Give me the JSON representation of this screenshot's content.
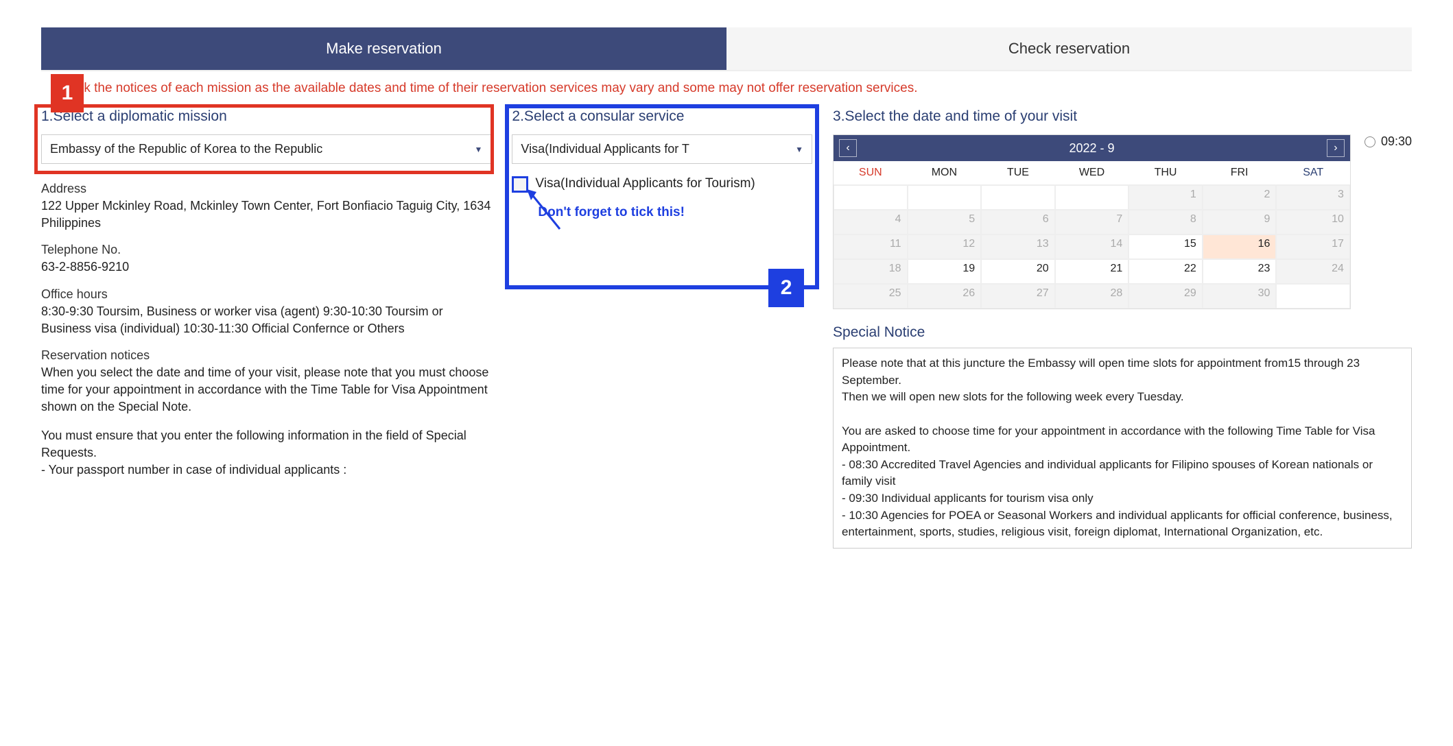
{
  "tabs": {
    "make": "Make reservation",
    "check": "Check reservation"
  },
  "top_notice": "check the notices of each mission as the available dates and time of their reservation services may vary and some may not offer reservation services.",
  "step1": {
    "title": "1.Select a diplomatic mission",
    "selected": "Embassy of the Republic of Korea to the Republic",
    "address_label": "Address",
    "address": "122 Upper Mckinley Road, Mckinley Town Center, Fort Bonfiacio Taguig City, 1634 Philippines",
    "tel_label": "Telephone No.",
    "tel": "63-2-8856-9210",
    "hours_label": "Office hours",
    "hours": "8:30-9:30 Toursim, Business or worker visa (agent) 9:30-10:30 Toursim or Business visa (individual) 10:30-11:30 Official Confernce or Others",
    "resv_label": "Reservation notices",
    "resv1": "When you select the date and time of your visit, please note that you must choose time for your appointment in accordance with the Time Table for Visa Appointment shown on the Special Note.",
    "resv2": "You must ensure that you enter the following information in the field of Special Requests.\n- Your passport number in case of individual applicants :"
  },
  "step2": {
    "title": "2.Select a consular service",
    "selected": "Visa(Individual Applicants for T",
    "option": "Visa(Individual Applicants for Tourism)",
    "tick_note": "Don't forget to tick this!"
  },
  "step3": {
    "title": "3.Select the date and time of your visit",
    "month": "2022 - 9",
    "dow": [
      "SUN",
      "MON",
      "TUE",
      "WED",
      "THU",
      "FRI",
      "SAT"
    ],
    "cells": [
      {
        "d": "",
        "cls": "empty"
      },
      {
        "d": "",
        "cls": "empty"
      },
      {
        "d": "",
        "cls": "empty"
      },
      {
        "d": "",
        "cls": "empty"
      },
      {
        "d": "1",
        "cls": "disabled"
      },
      {
        "d": "2",
        "cls": "disabled"
      },
      {
        "d": "3",
        "cls": "disabled"
      },
      {
        "d": "4",
        "cls": "disabled"
      },
      {
        "d": "5",
        "cls": "disabled"
      },
      {
        "d": "6",
        "cls": "disabled"
      },
      {
        "d": "7",
        "cls": "disabled"
      },
      {
        "d": "8",
        "cls": "disabled"
      },
      {
        "d": "9",
        "cls": "disabled"
      },
      {
        "d": "10",
        "cls": "disabled"
      },
      {
        "d": "11",
        "cls": "disabled"
      },
      {
        "d": "12",
        "cls": "disabled"
      },
      {
        "d": "13",
        "cls": "disabled"
      },
      {
        "d": "14",
        "cls": "disabled"
      },
      {
        "d": "15",
        "cls": ""
      },
      {
        "d": "16",
        "cls": "selected"
      },
      {
        "d": "17",
        "cls": "disabled"
      },
      {
        "d": "18",
        "cls": "disabled"
      },
      {
        "d": "19",
        "cls": ""
      },
      {
        "d": "20",
        "cls": ""
      },
      {
        "d": "21",
        "cls": ""
      },
      {
        "d": "22",
        "cls": ""
      },
      {
        "d": "23",
        "cls": ""
      },
      {
        "d": "24",
        "cls": "disabled"
      },
      {
        "d": "25",
        "cls": "disabled"
      },
      {
        "d": "26",
        "cls": "disabled"
      },
      {
        "d": "27",
        "cls": "disabled"
      },
      {
        "d": "28",
        "cls": "disabled"
      },
      {
        "d": "29",
        "cls": "disabled"
      },
      {
        "d": "30",
        "cls": "disabled"
      },
      {
        "d": "",
        "cls": "empty"
      }
    ],
    "time_option": "09:30",
    "special_title": "Special Notice",
    "special_body": "Please note that at this juncture the Embassy will open time slots for appointment from15 through 23 September.\nThen we will open new slots for the following week every Tuesday.\n\nYou are asked to choose time for your appointment in accordance with the following Time Table for Visa Appointment.\n- 08:30   Accredited Travel Agencies and individual applicants for Filipino spouses of Korean nationals or family visit\n- 09:30   Individual applicants for tourism visa only\n- 10:30   Agencies for POEA or Seasonal Workers and individual applicants for official conference, business, entertainment, sports, studies, religious visit, foreign diplomat, International Organization, etc."
  },
  "badges": {
    "one": "1",
    "two": "2"
  }
}
